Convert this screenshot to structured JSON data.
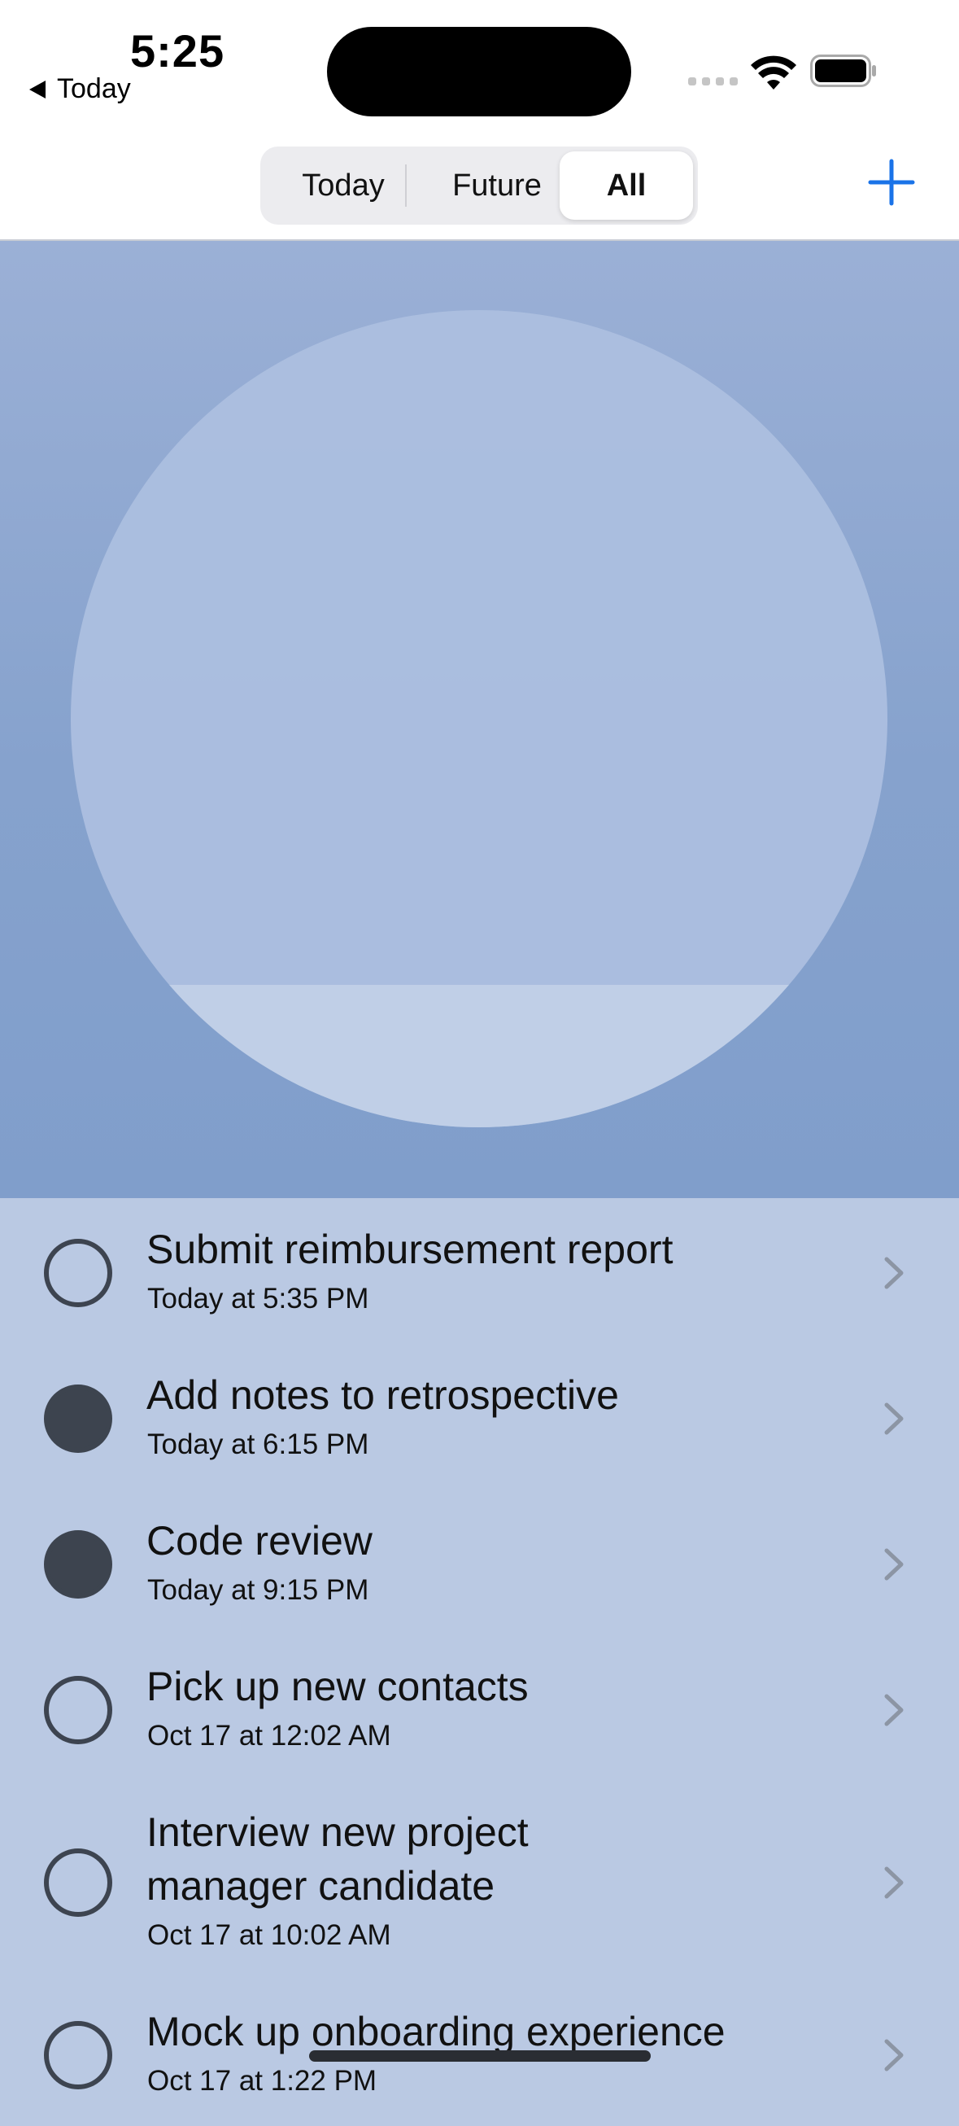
{
  "status_bar": {
    "time": "5:25",
    "back_label": "Today"
  },
  "segmented": {
    "today_label": "Today",
    "future_label": "Future",
    "all_label": "All",
    "selected": "All"
  },
  "reminders": [
    {
      "title": "Submit reimbursement report",
      "date": "Today at 5:35 PM",
      "completed": false
    },
    {
      "title": "Add notes to retrospective",
      "date": "Today at 6:15 PM",
      "completed": true
    },
    {
      "title": "Code review",
      "date": "Today at 9:15 PM",
      "completed": true
    },
    {
      "title": "Pick up new contacts",
      "date": "Oct 17 at 12:02 AM",
      "completed": false
    },
    {
      "title": "Interview new project manager candidate",
      "date": "Oct 17 at 10:02 AM",
      "completed": false
    },
    {
      "title": "Mock up onboarding experience",
      "date": "Oct 17 at 1:22 PM",
      "completed": false
    }
  ],
  "colors": {
    "accent": "#1a73e8",
    "hero_top": "#9bb0d6",
    "hero_bottom": "#809ecb",
    "list_background": "#bac9e3",
    "checkbox": "#3d444f"
  }
}
